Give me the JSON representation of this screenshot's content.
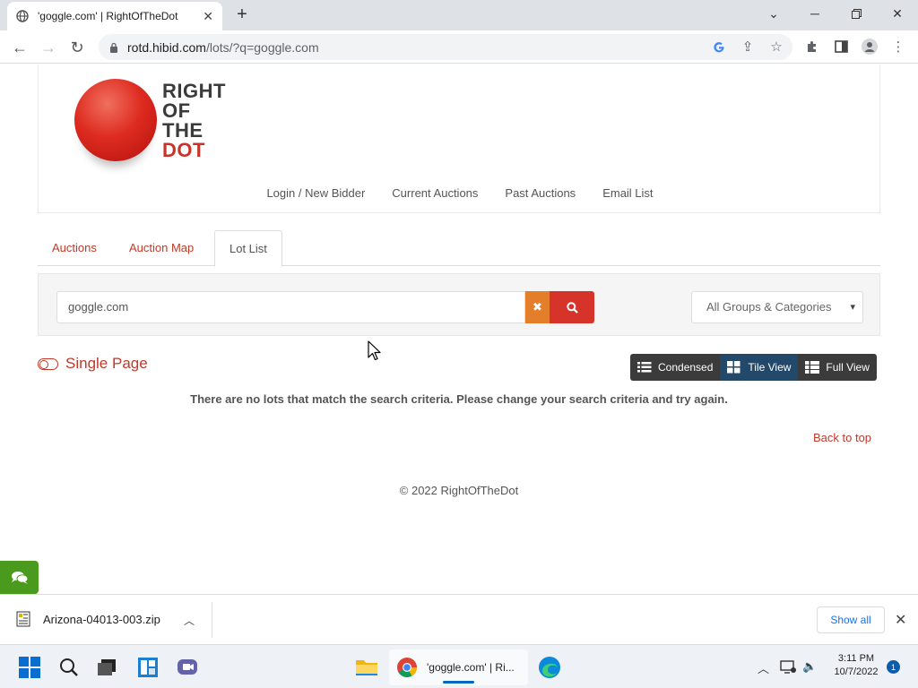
{
  "browser": {
    "tab_title": "'goggle.com' | RightOfTheDot",
    "url_host": "rotd.hibid.com",
    "url_path": "/lots/?q=goggle.com"
  },
  "logo": {
    "line1": "RIGHT",
    "line2": "OF",
    "line3": "THE",
    "line4": "DOT"
  },
  "main_nav": {
    "login": "Login / New Bidder",
    "current": "Current Auctions",
    "past": "Past Auctions",
    "email": "Email List"
  },
  "page_tabs": {
    "auctions": "Auctions",
    "map": "Auction Map",
    "lot_list": "Lot List"
  },
  "search": {
    "value": "goggle.com",
    "category_selected": "All Groups & Categories"
  },
  "single_page_label": "Single Page",
  "views": {
    "condensed": "Condensed",
    "tile": "Tile View",
    "full": "Full View"
  },
  "no_lots_message": "There are no lots that match the search criteria. Please change your search criteria and try again.",
  "back_to_top": "Back to top",
  "copyright": "© 2022 RightOfTheDot",
  "downloads": {
    "file_name": "Arizona-04013-003.zip",
    "show_all": "Show all"
  },
  "taskbar": {
    "chrome_item": "'goggle.com' | Ri...",
    "time": "3:11 PM",
    "date": "10/7/2022",
    "notifications": "1"
  },
  "colors": {
    "accent_red": "#c0392b",
    "clear_orange": "#e37e2a",
    "search_red": "#d6332a",
    "active_view": "#23496a",
    "chat_green": "#4a9a1e"
  }
}
